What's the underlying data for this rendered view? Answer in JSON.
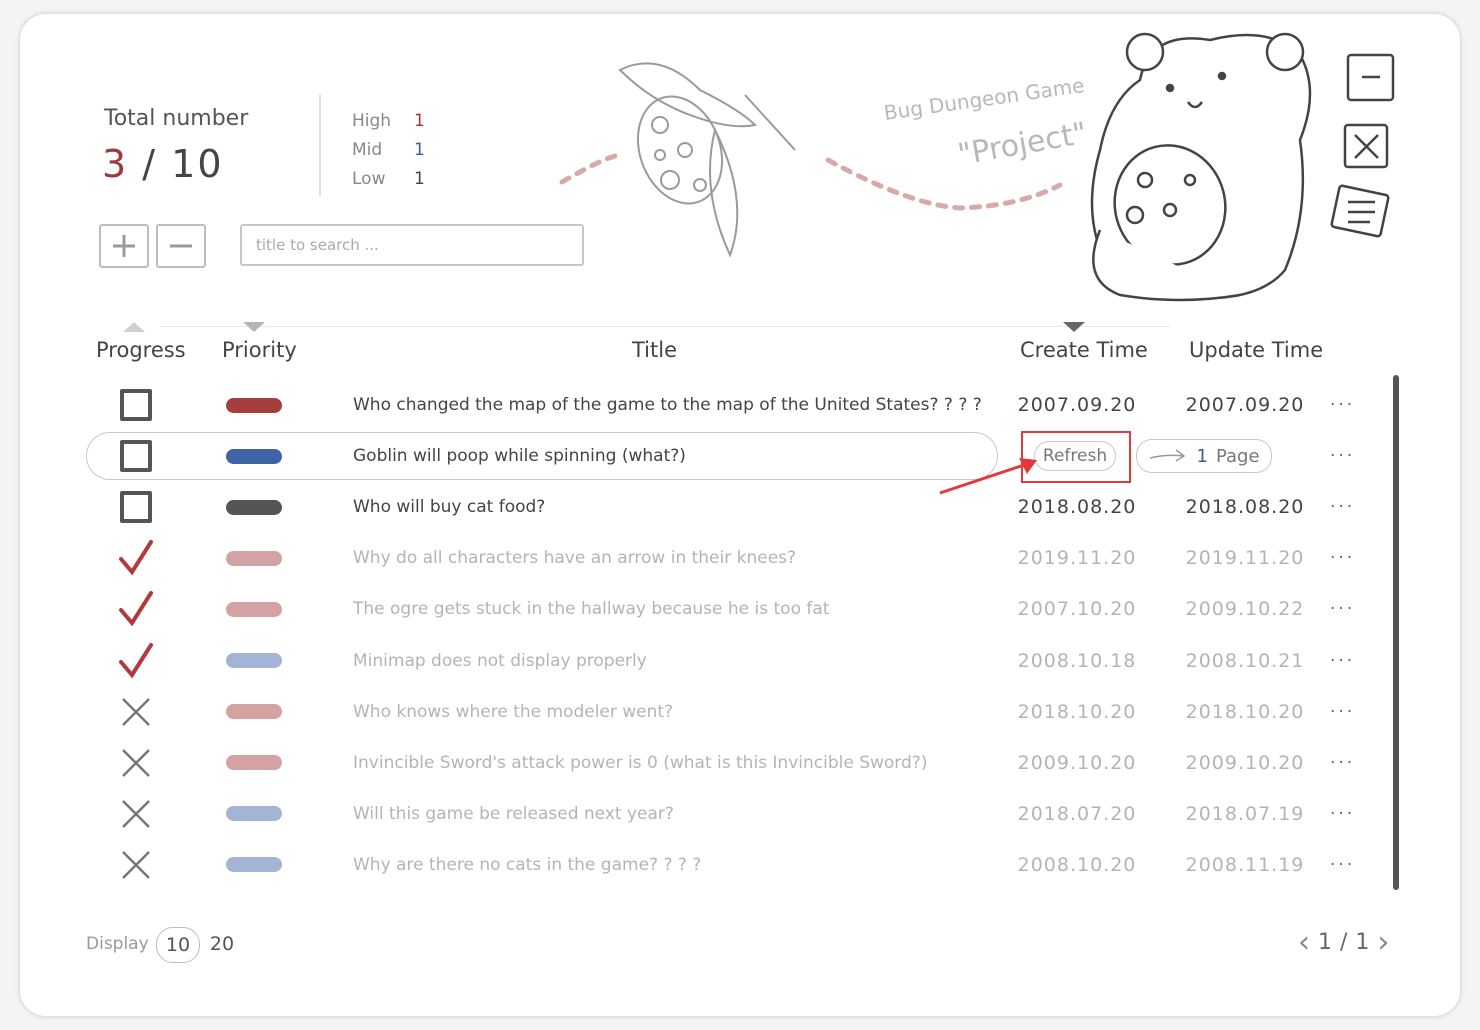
{
  "header": {
    "total_label": "Total number",
    "done_count": "3",
    "total_count": "10",
    "priority_stats": [
      {
        "label": "High",
        "value": "1",
        "color": "#a0383a"
      },
      {
        "label": "Mid",
        "value": "1",
        "color": "#3a5aa0"
      },
      {
        "label": "Low",
        "value": "1",
        "color": "#444444"
      }
    ],
    "search_placeholder": "title to search ..."
  },
  "illustration": {
    "title_line1": "Bug Dungeon Game",
    "title_line2": "\"Project\""
  },
  "columns": {
    "progress": "Progress",
    "priority": "Priority",
    "title": "Title",
    "create_time": "Create Time",
    "update_time": "Update Time"
  },
  "colors": {
    "high": "#a53c3e",
    "mid": "#3f63a6",
    "low": "#555555",
    "high_faded": "#d4a2a3",
    "mid_faded": "#a3b4d4",
    "check": "#b03a3d",
    "cross": "#777777",
    "highlight": "#e23a3a"
  },
  "rows": [
    {
      "status": "open",
      "priority": "high",
      "title": "Who changed the map of the game to the map of the United States? ? ? ?",
      "create": "2007.09.20",
      "update": "2007.09.20",
      "more": "···"
    },
    {
      "status": "open",
      "priority": "mid",
      "title": "Goblin will poop while spinning (what?)",
      "create": "",
      "update": "",
      "more": "···"
    },
    {
      "status": "open",
      "priority": "low",
      "title": "Who will buy cat food?",
      "create": "2018.08.20",
      "update": "2018.08.20",
      "more": "···"
    },
    {
      "status": "done",
      "priority": "high_faded",
      "title": "Why do all characters have an arrow in their knees?",
      "create": "2019.11.20",
      "update": "2019.11.20",
      "more": "···"
    },
    {
      "status": "done",
      "priority": "high_faded",
      "title": "The ogre gets stuck in the hallway because he is too fat",
      "create": "2007.10.20",
      "update": "2009.10.22",
      "more": "···"
    },
    {
      "status": "done",
      "priority": "mid_faded",
      "title": "Minimap does not display properly",
      "create": "2008.10.18",
      "update": "2008.10.21",
      "more": "···"
    },
    {
      "status": "closed",
      "priority": "high_faded",
      "title": "Who knows where the modeler went?",
      "create": "2018.10.20",
      "update": "2018.10.20",
      "more": "···"
    },
    {
      "status": "closed",
      "priority": "high_faded",
      "title": "Invincible Sword's attack power is 0 (what is this Invincible Sword?)",
      "create": "2009.10.20",
      "update": "2009.10.20",
      "more": "···"
    },
    {
      "status": "closed",
      "priority": "mid_faded",
      "title": "Will this game be released next year?",
      "create": "2018.07.20",
      "update": "2018.07.19",
      "more": "···"
    },
    {
      "status": "closed",
      "priority": "mid_faded",
      "title": "Why are there no cats in the game? ? ? ?",
      "create": "2008.10.20",
      "update": "2008.11.19",
      "more": "···"
    }
  ],
  "row_actions": {
    "refresh_label": "Refresh",
    "page_number": "1",
    "page_label": "Page"
  },
  "footer": {
    "display_label": "Display",
    "display_options": [
      "10",
      "20"
    ],
    "selected_display": "10",
    "current_page": "1",
    "total_pages": "1",
    "separator": "/"
  }
}
